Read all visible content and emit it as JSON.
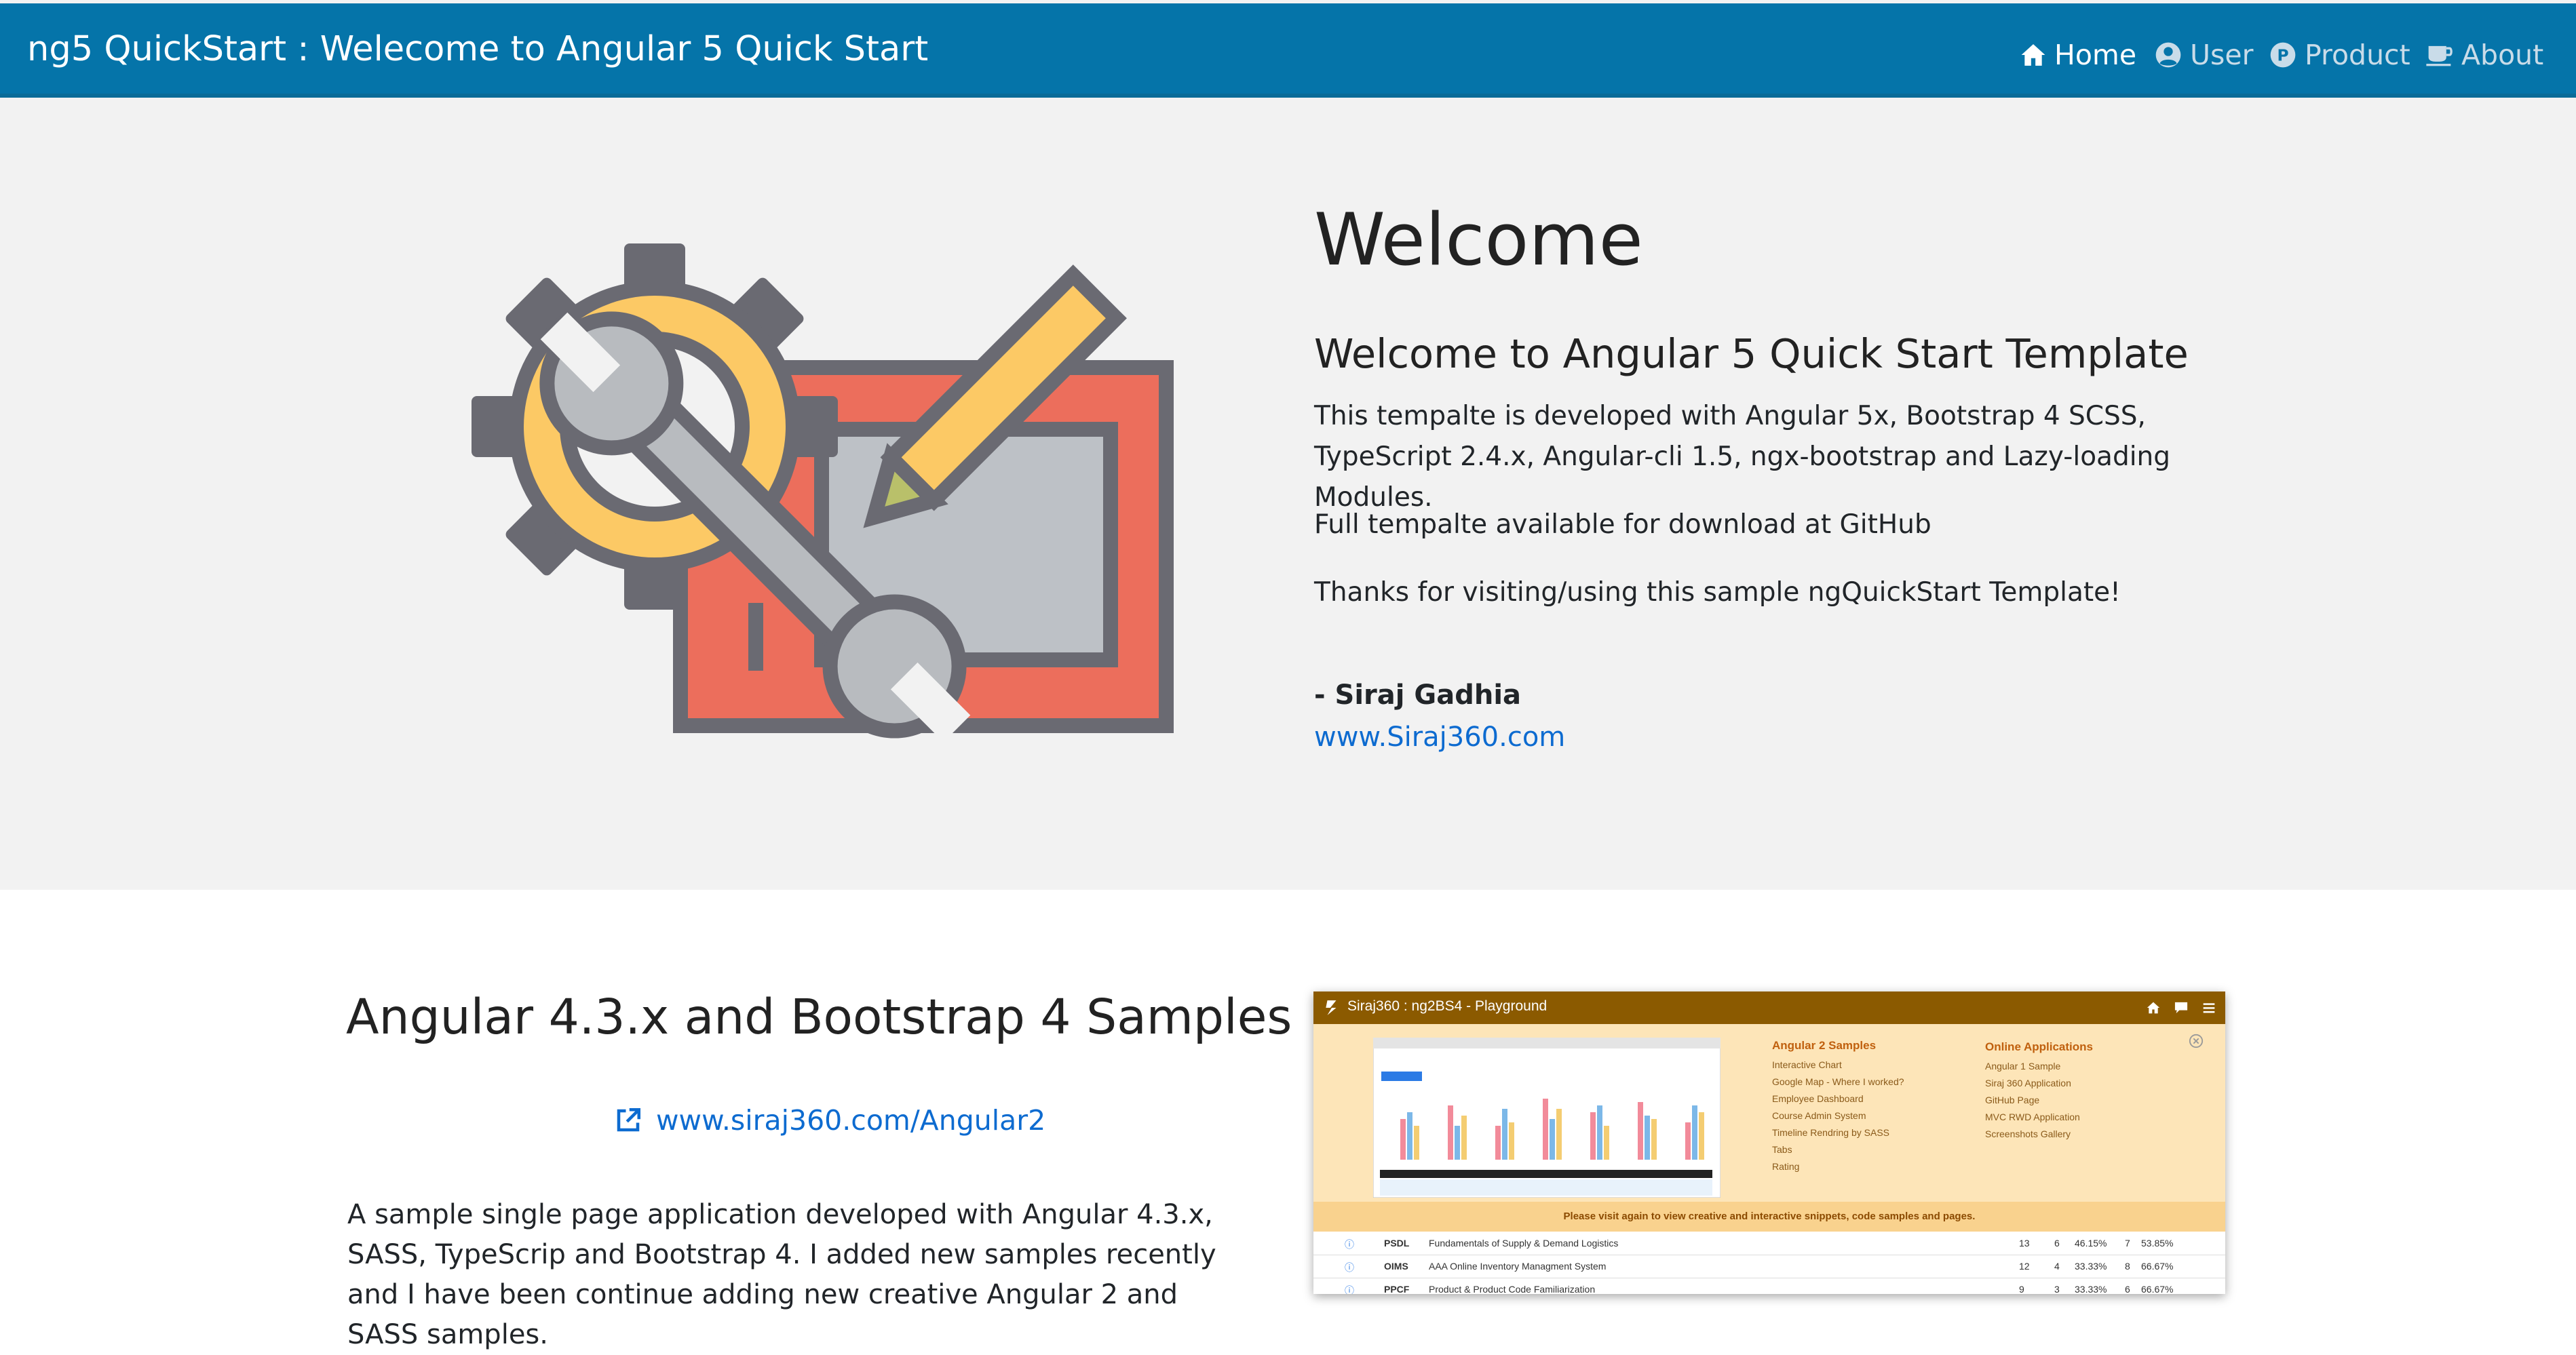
{
  "navbar": {
    "brand": "ng5 QuickStart : Welecome to Angular 5 Quick Start",
    "items": [
      {
        "label": "Home",
        "icon": "home-icon",
        "active": true
      },
      {
        "label": "User",
        "icon": "user-icon",
        "active": false
      },
      {
        "label": "Product",
        "icon": "product-icon",
        "active": false
      },
      {
        "label": "About",
        "icon": "coffee-icon",
        "active": false
      }
    ]
  },
  "hero": {
    "title": "Welcome",
    "subtitle": "Welcome to Angular 5 Quick Start Template",
    "paragraph1": "This tempalte is developed with Angular 5x, Bootstrap 4 SCSS, TypeScript 2.4.x, Angular-cli 1.5, ngx-bootstrap and Lazy-loading Modules.",
    "paragraph2": "Full tempalte available for download at GitHub",
    "paragraph3": "Thanks for visiting/using this sample ngQuickStart Template!",
    "author": "- Siraj Gadhia",
    "author_link": "www.Siraj360.com",
    "illustration_icon": "tools-settings-icon"
  },
  "samples": {
    "title": "Angular 4.3.x and Bootstrap 4 Samples",
    "link": "www.siraj360.com/Angular2",
    "paragraph": "A sample single page application developed with Angular 4.3.x, SASS, TypeScrip and Bootstrap 4. I added new samples recently and I have been continue adding new creative Angular 2 and SASS samples."
  },
  "thumbnail": {
    "title": "Siraj360 : ng2BS4 - Playground",
    "col1_title": "Angular 2 Samples",
    "col1_items": [
      "Interactive Chart",
      "Google Map - Where I worked?",
      "Employee Dashboard",
      "Course Admin System",
      "Timeline Rendring by SASS",
      "Tabs",
      "Rating"
    ],
    "col2_title": "Online Applications",
    "col2_items": [
      "Angular 1 Sample",
      "Siraj 360 Application",
      "GitHub Page",
      "MVC RWD Application",
      "Screenshots Gallery"
    ],
    "notice": "Please visit again to view creative and interactive snippets, code samples and pages.",
    "rows": [
      {
        "code": "PSDL",
        "name": "Fundamentals of Supply & Demand Logistics",
        "a": "13",
        "b": "6",
        "c": "46.15%",
        "d": "7",
        "e": "53.85%"
      },
      {
        "code": "OIMS",
        "name": "AAA Online Inventory Managment System",
        "a": "12",
        "b": "4",
        "c": "33.33%",
        "d": "8",
        "e": "66.67%"
      },
      {
        "code": "PPCF",
        "name": "Product & Product Code Familiarization",
        "a": "9",
        "b": "3",
        "c": "33.33%",
        "d": "6",
        "e": "66.67%"
      }
    ]
  },
  "colors": {
    "navbar": "#0574a9",
    "hero_bg": "#f2f2f2",
    "link": "#0d6bd0",
    "thumb_bar": "#8b5a00",
    "thumb_panel": "#fde5b8"
  }
}
